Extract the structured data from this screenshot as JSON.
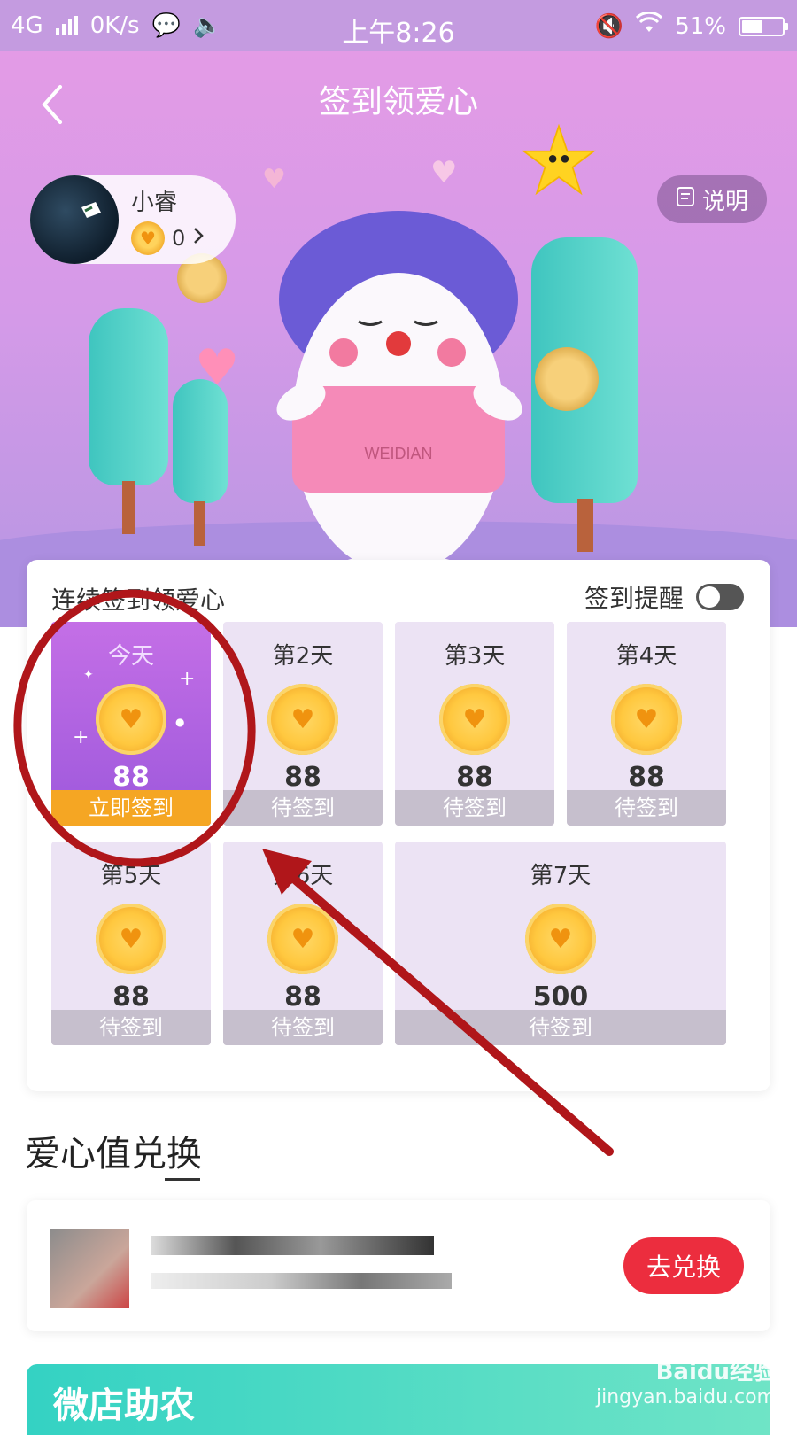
{
  "status_bar": {
    "network": "4G",
    "speed": "0K/s",
    "time": "上午8:26",
    "battery": "51%"
  },
  "header": {
    "title": "签到领爱心",
    "explain_label": "说明"
  },
  "user": {
    "name": "小睿",
    "points": "0"
  },
  "mascot": {
    "shirt_text": "WEIDIAN"
  },
  "signin": {
    "title": "连续签到领爱心",
    "reminder_label": "签到提醒",
    "reminder_on": false,
    "days": [
      {
        "label": "今天",
        "amount": "88",
        "status": "立即签到"
      },
      {
        "label": "第2天",
        "amount": "88",
        "status": "待签到"
      },
      {
        "label": "第3天",
        "amount": "88",
        "status": "待签到"
      },
      {
        "label": "第4天",
        "amount": "88",
        "status": "待签到"
      },
      {
        "label": "第5天",
        "amount": "88",
        "status": "待签到"
      },
      {
        "label": "第6天",
        "amount": "88",
        "status": "待签到"
      },
      {
        "label": "第7天",
        "amount": "500",
        "status": "待签到"
      }
    ]
  },
  "exchange": {
    "title": "爱心值兑换",
    "button_label": "去兑换"
  },
  "promo": {
    "text": "微店助农"
  },
  "watermark": {
    "line1": "Baidu经验",
    "line2": "jingyan.baidu.com"
  },
  "colors": {
    "accent": "#ec2d3e",
    "today_tile": "#a55fde",
    "today_button": "#f5a623",
    "annotation": "#b0161a"
  }
}
